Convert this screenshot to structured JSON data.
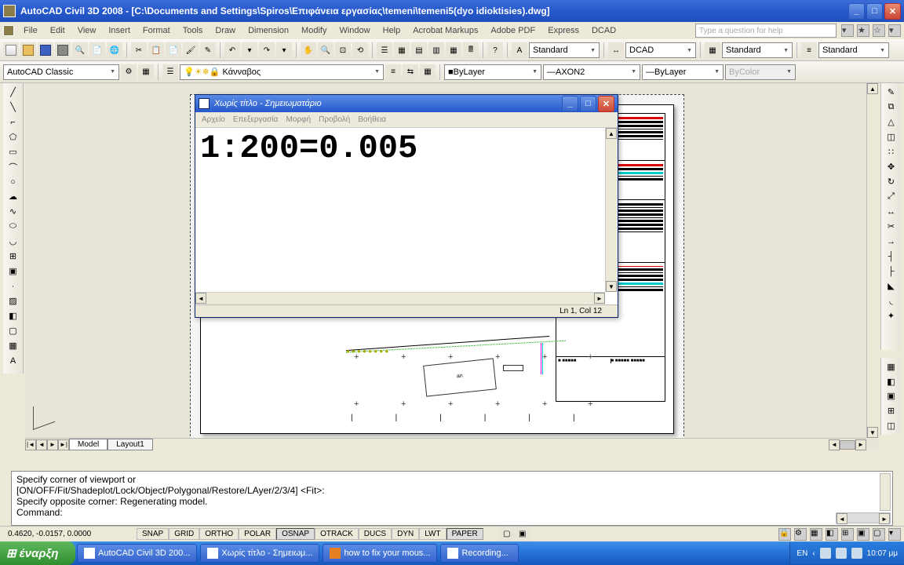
{
  "title": "AutoCAD Civil 3D 2008 - [C:\\Documents and Settings\\Spiros\\Επιφάνεια εργασίας\\temeni\\temeni5(dyo idioktisies).dwg]",
  "menu": [
    "File",
    "Edit",
    "View",
    "Insert",
    "Format",
    "Tools",
    "Draw",
    "Dimension",
    "Modify",
    "Window",
    "Help",
    "Acrobat Markups",
    "Adobe PDF",
    "Express",
    "DCAD"
  ],
  "search_placeholder": "Type a question for help",
  "workspace": "AutoCAD Classic",
  "layer": "Κάνναβος",
  "tb_styles": {
    "textstyle": "Standard",
    "dimstyle": "DCAD",
    "tablestyle": "Standard",
    "s4": "Standard"
  },
  "linetype1": "ByLayer",
  "linetype2": "AXON2",
  "linetype3": "ByLayer",
  "linecolor": "ByColor",
  "tabs": {
    "model": "Model",
    "layout": "Layout1"
  },
  "cmd": {
    "l1": "Specify corner of viewport or",
    "l2": "[ON/OFF/Fit/Shadeplot/Lock/Object/Polygonal/Restore/LAyer/2/3/4] <Fit>:",
    "l3": "Specify opposite corner: Regenerating model.",
    "l4": "Command:"
  },
  "coords": "0.4620, -0.0157, 0.0000",
  "status_btns": [
    "SNAP",
    "GRID",
    "ORTHO",
    "POLAR",
    "OSNAP",
    "OTRACK",
    "DUCS",
    "DYN",
    "LWT",
    "PAPER"
  ],
  "notepad": {
    "title": "Χωρίς τίτλο - Σημειωματάριο",
    "menu": [
      "Αρχείο",
      "Επεξεργασία",
      "Μορφή",
      "Προβολή",
      "Βοήθεια"
    ],
    "content": "1:200=0.005",
    "status": "Ln 1, Col 12"
  },
  "taskbar": {
    "start": "έναρξη",
    "tasks": [
      {
        "label": "AutoCAD Civil 3D 200..."
      },
      {
        "label": "Χωρίς τίτλο - Σημειωμ..."
      },
      {
        "label": "how to fix your mous..."
      },
      {
        "label": "Recording..."
      }
    ],
    "lang": "EN",
    "time": "10:07 μμ"
  },
  "dwg_label": "an"
}
